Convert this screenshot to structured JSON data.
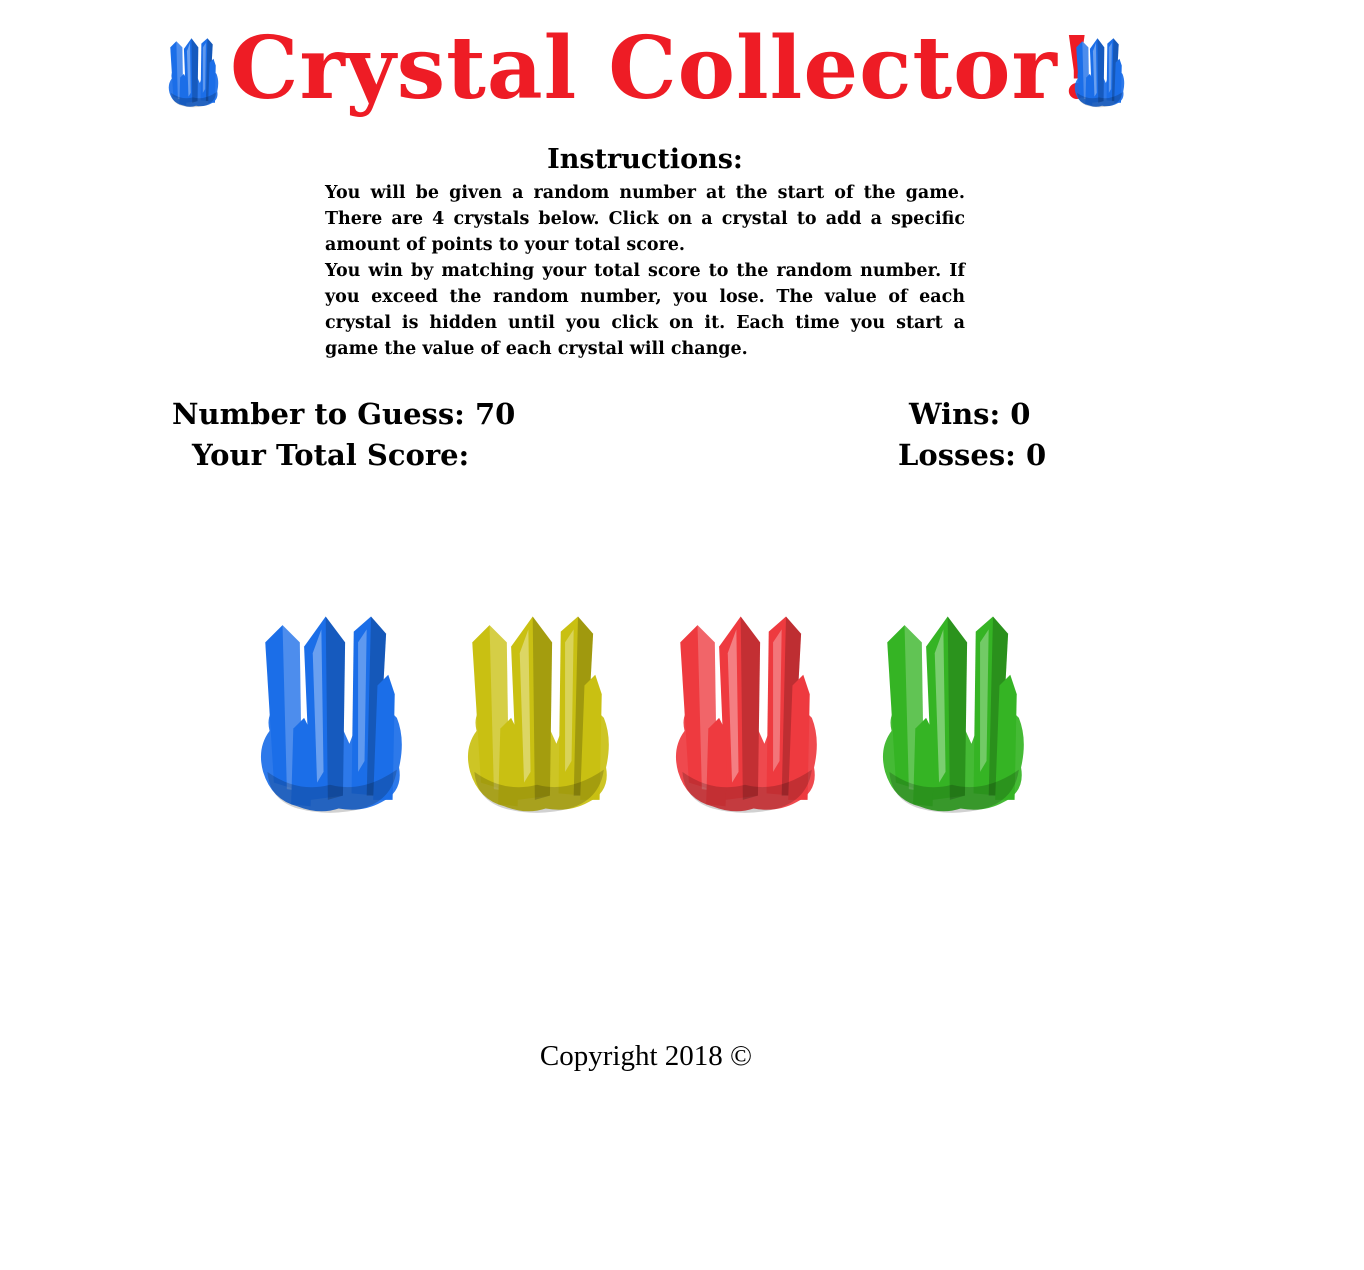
{
  "header": {
    "title": "Crystal Collector!",
    "title_color": "#ee1c25",
    "side_icon": "blue-crystal-icon"
  },
  "instructions": {
    "heading": "Instructions:",
    "paragraph_1": "You will be given a random number at the start of the game. There are 4 crystals below. Click on a crystal to add a specific amount of points to your total score.",
    "paragraph_2": "You win by matching your total score to the random number. If you exceed the random number, you lose. The value of each crystal is hidden until you click on it. Each time you start a game the value of each crystal will change."
  },
  "stats": {
    "number_to_guess_label": "Number to Guess: 70",
    "total_score_label": "Your Total Score:",
    "wins_label": "Wins: 0",
    "losses_label": "Losses: 0"
  },
  "crystals": [
    {
      "name": "blue-crystal",
      "color": "#1b6ee8"
    },
    {
      "name": "yellow-crystal",
      "color": "#c9c012"
    },
    {
      "name": "red-crystal",
      "color": "#ee3a3f"
    },
    {
      "name": "green-crystal",
      "color": "#35b424"
    }
  ],
  "footer": {
    "copyright": "Copyright 2018 ©"
  }
}
